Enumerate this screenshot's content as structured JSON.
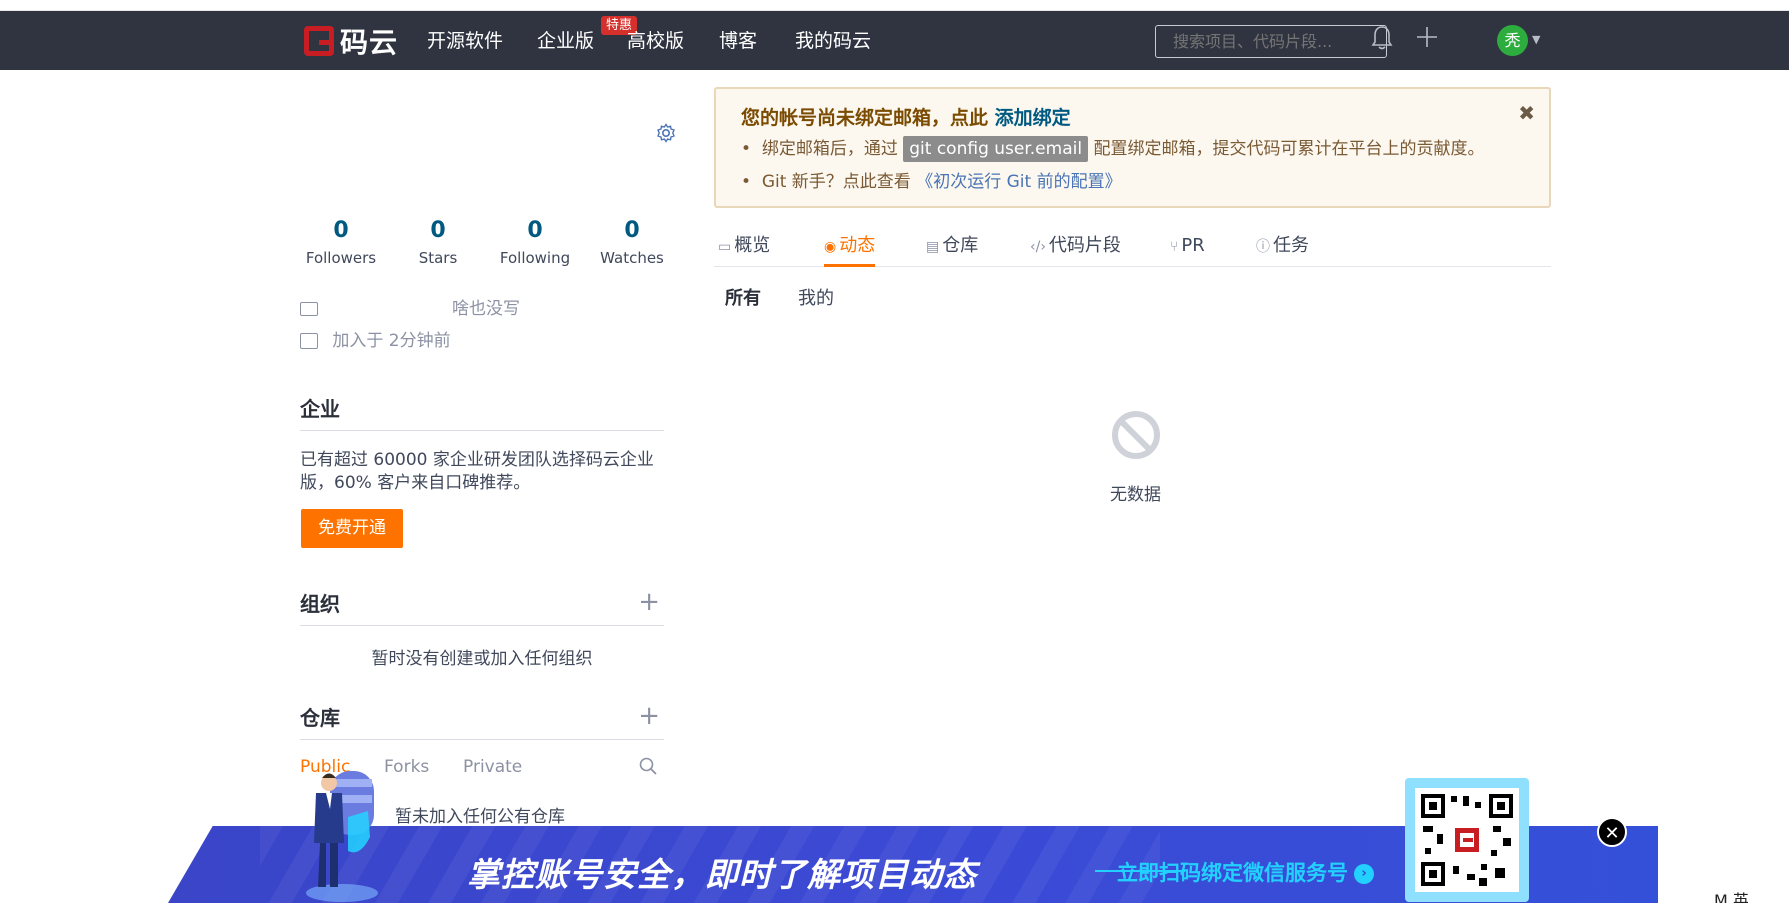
{
  "navbar": {
    "logo_text": "码云",
    "items": [
      "开源软件",
      "企业版",
      "高校版",
      "博客",
      "我的码云"
    ],
    "badge": "特惠",
    "search_placeholder": "搜索项目、代码片段...",
    "avatar_text": "秃"
  },
  "profile": {
    "stats": [
      {
        "value": "0",
        "label": "Followers"
      },
      {
        "value": "0",
        "label": "Stars"
      },
      {
        "value": "0",
        "label": "Following"
      },
      {
        "value": "0",
        "label": "Watches"
      }
    ],
    "bio": "啥也没写",
    "joined": "加入于 2分钟前"
  },
  "enterprise": {
    "title": "企业",
    "text": "已有超过 60000 家企业研发团队选择码云企业版，60% 客户来自口碑推荐。",
    "button": "免费开通"
  },
  "organization": {
    "title": "组织",
    "empty": "暂时没有创建或加入任何组织"
  },
  "repos": {
    "title": "仓库",
    "tabs": [
      "Public",
      "Forks",
      "Private"
    ],
    "empty": "暂未加入任何公有仓库"
  },
  "alert": {
    "title_prefix": "您的帐号尚未绑定邮箱，点此",
    "title_link": "添加绑定",
    "line1_prefix": "绑定邮箱后，通过",
    "line1_code": "git config user.email",
    "line1_suffix": "配置绑定邮箱，提交代码可累计在平台上的贡献度。",
    "line2_prefix": "Git 新手？点此查看",
    "line2_link": "《初次运行 Git 前的配置》"
  },
  "tabs": [
    "概览",
    "动态",
    "仓库",
    "代码片段",
    "PR",
    "任务"
  ],
  "active_tab": "动态",
  "subtabs": [
    "所有",
    "我的"
  ],
  "empty_state": "无数据",
  "banner": {
    "title": "掌控账号安全，即时了解项目动态",
    "cta": "立即扫码绑定微信服务号"
  },
  "ime": "M 英"
}
